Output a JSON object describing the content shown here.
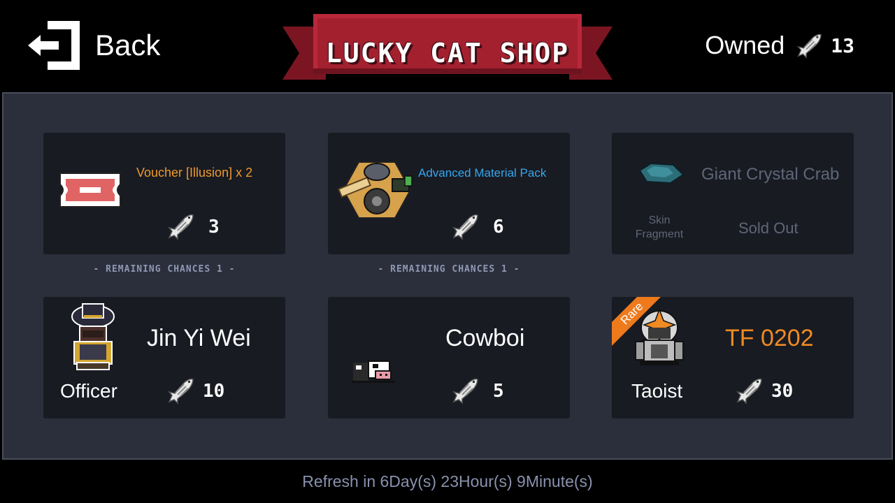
{
  "header": {
    "back_label": "Back",
    "shop_title": "LUCKY CAT SHOP",
    "owned_label": "Owned",
    "owned_count": "13"
  },
  "remaining_label": "- REMAINING CHANCES 1 -",
  "items": [
    {
      "title": "Voucher [Illusion] x 2",
      "price": "3",
      "title_color": "#ef9a2b"
    },
    {
      "title": "Advanced Material Pack",
      "price": "6",
      "title_color": "#35a6f0"
    },
    {
      "title": "Giant Crystal Crab",
      "sub_label": "Skin Fragment",
      "status": "Sold Out"
    },
    {
      "title": "Jin Yi Wei",
      "sub_label": "Officer",
      "price": "10"
    },
    {
      "title": "Cowboi",
      "price": "5"
    },
    {
      "title": "TF 0202",
      "sub_label": "Taoist",
      "price": "30",
      "badge": "Rare",
      "title_color": "#f08a22"
    }
  ],
  "footer": {
    "refresh_text": "Refresh in 6Day(s) 23Hour(s) 9Minute(s)"
  },
  "colors": {
    "panel_bg": "#2b2f3b",
    "card_bg": "#181b22",
    "banner_red": "#a3202f",
    "rare_orange": "#ee7a1c"
  }
}
